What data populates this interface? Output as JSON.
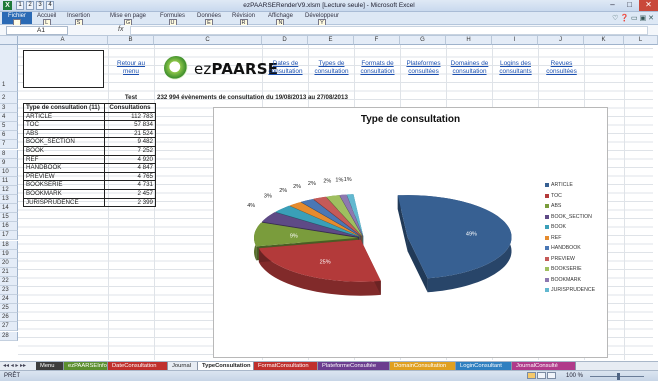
{
  "window": {
    "title": "ezPAARSERenderV9.xlsm [Lecture seule] - Microsoft Excel",
    "minimize": "–",
    "maximize": "□",
    "close": "✕"
  },
  "quick_access": [
    "1",
    "2",
    "3",
    "4"
  ],
  "ribbon": {
    "tabs": [
      {
        "label": "Fichier",
        "key": "F"
      },
      {
        "label": "Accueil",
        "key": "L"
      },
      {
        "label": "Insertion",
        "key": "S"
      },
      {
        "label": "Mise en page",
        "key": "G"
      },
      {
        "label": "Formules",
        "key": "U"
      },
      {
        "label": "Données",
        "key": "E"
      },
      {
        "label": "Révision",
        "key": "R"
      },
      {
        "label": "Affichage",
        "key": "N"
      },
      {
        "label": "Développeur",
        "key": "Y"
      }
    ]
  },
  "formula_bar": {
    "name_box": "A1",
    "fx": "fx",
    "value": ""
  },
  "columns": [
    "A",
    "B",
    "C",
    "D",
    "E",
    "F",
    "G",
    "H",
    "I",
    "J",
    "K",
    "L"
  ],
  "rows": [
    "1",
    "2",
    "3",
    "4",
    "5",
    "6",
    "7",
    "8",
    "9",
    "10",
    "11",
    "12",
    "13",
    "14",
    "15",
    "16",
    "17",
    "18",
    "19",
    "20",
    "21",
    "22",
    "23",
    "24",
    "25",
    "26",
    "27",
    "28"
  ],
  "header_links": {
    "b1": "Retour au menu",
    "d1": "Dates de consultation",
    "e1": "Types de consultation",
    "f1": "Formats de consultation",
    "g1": "Plateformes consultées",
    "h1": "Domaines de consultation",
    "i1": "Logins des consultants",
    "j1": "Revues consultées"
  },
  "logo": {
    "prefix": "ez",
    "word": "PAARSE"
  },
  "b2": "Test",
  "summary": "232 994 évènements de consultation du 19/08/2013 au 27/08/2013",
  "table": {
    "header": [
      "Type de consultation (11)",
      "Consultations"
    ],
    "rows": [
      [
        "ARTICLE",
        "112 783"
      ],
      [
        "TOC",
        "57 834"
      ],
      [
        "ABS",
        "21 524"
      ],
      [
        "BOOK_SECTION",
        "9 482"
      ],
      [
        "BOOK",
        "7 252"
      ],
      [
        "REF",
        "4 920"
      ],
      [
        "HANDBOOK",
        "4 847"
      ],
      [
        "PREVIEW",
        "4 765"
      ],
      [
        "BOOKSERIE",
        "4 731"
      ],
      [
        "BOOKMARK",
        "2 457"
      ],
      [
        "JURISPRUDENCE",
        "2 399"
      ]
    ]
  },
  "chart_data": {
    "type": "pie",
    "title": "Type de consultation",
    "categories": [
      "ARTICLE",
      "TOC",
      "ABS",
      "BOOK_SECTION",
      "BOOK",
      "REF",
      "HANDBOOK",
      "PREVIEW",
      "BOOKSERIE",
      "BOOKMARK",
      "JURISPRUDENCE"
    ],
    "values": [
      112783,
      57834,
      21524,
      9482,
      7252,
      4920,
      4847,
      4765,
      4731,
      2457,
      2399
    ],
    "data_labels": [
      "49%",
      "25%",
      "9%",
      "4%",
      "3%",
      "2%",
      "2%",
      "2%",
      "2%",
      "1%",
      "1%"
    ],
    "colors": [
      "#376092",
      "#b33a3a",
      "#7a9c3c",
      "#5e4a86",
      "#3a9fb8",
      "#e58b2e",
      "#4a77b5",
      "#c55a58",
      "#9fbf5f",
      "#8d78b0",
      "#62b8d0"
    ],
    "legend_position": "right"
  },
  "sheet_tabs": [
    {
      "label": "Menu",
      "color": "#3d3d3d"
    },
    {
      "label": "ezPAARSEInfo",
      "color": "#5b8f2f"
    },
    {
      "label": "DateConsultation",
      "color": "#c0302d"
    },
    {
      "label": "Journal",
      "color": ""
    },
    {
      "label": "TypeConsultation",
      "color": "",
      "active": true
    },
    {
      "label": "FormatConsultation",
      "color": "#c0302d"
    },
    {
      "label": "PlateformeConsultée",
      "color": "#6b3d8f"
    },
    {
      "label": "DomainConsultation",
      "color": "#e0a020"
    },
    {
      "label": "LoginConsultant",
      "color": "#2f7fc0"
    },
    {
      "label": "JournalConsulté",
      "color": "#b03a8a"
    }
  ],
  "status": {
    "mode": "PRÊT",
    "zoom": "100 %"
  }
}
